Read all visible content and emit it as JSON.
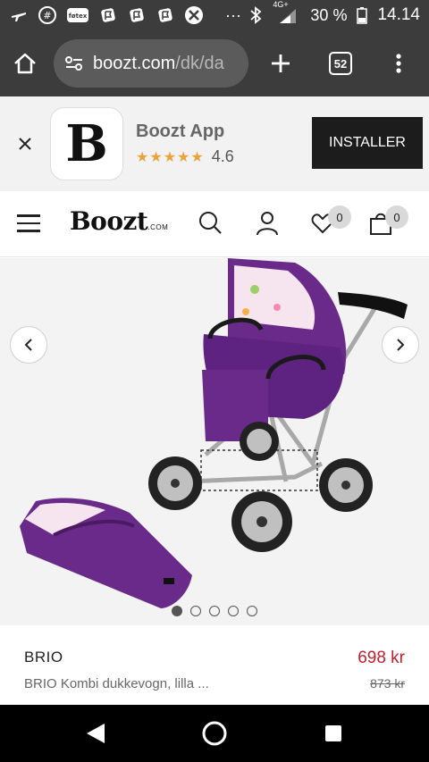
{
  "status_bar": {
    "notification_icons": [
      "plane-icon",
      "hashtag-icon",
      "fotex-icon",
      "flag-icon",
      "flag-icon",
      "flag-icon",
      "cross-icon"
    ],
    "fotex_label": "føtex",
    "more": "···",
    "network": "4G+",
    "battery": "30 %",
    "time": "14.14"
  },
  "browser": {
    "url_host": "boozt.com",
    "url_path": "/dk/da",
    "tab_count": "52"
  },
  "app_banner": {
    "logo_letter": "B",
    "app_name": "Boozt App",
    "stars": "★★★★★",
    "rating": "4.6",
    "install_label": "INSTALLER"
  },
  "site_header": {
    "logo_text": "Boozt",
    "logo_suffix": ".COM",
    "wishlist_count": "0",
    "cart_count": "0"
  },
  "gallery": {
    "total_images": 5,
    "active_index": 0
  },
  "product": {
    "brand": "BRIO",
    "name": "BRIO Kombi dukkevogn, lilla ...",
    "price": "698 kr",
    "old_price": "873 kr"
  },
  "colors": {
    "status_bg": "#3c3c3c",
    "install_bg": "#1c1c1c",
    "price_red": "#c0202c",
    "stars": "#e8a33c",
    "stroller_purple": "#6a2a8a"
  }
}
